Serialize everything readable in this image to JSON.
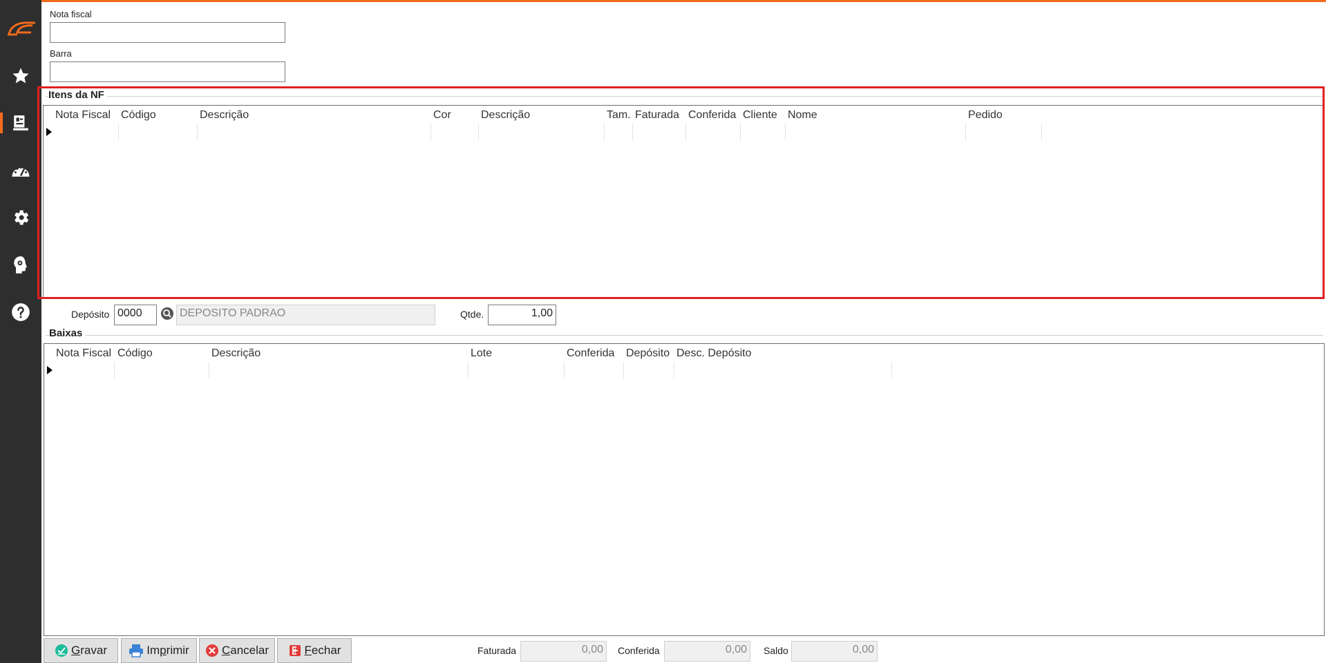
{
  "form": {
    "nota_fiscal_label": "Nota fiscal",
    "nota_fiscal_value": "",
    "barra_label": "Barra",
    "barra_value": ""
  },
  "itens": {
    "title": "Itens da NF",
    "columns": [
      "Nota Fiscal",
      "Código",
      "Descrição",
      "Cor",
      "Descrição",
      "Tam.",
      "Faturada",
      "Conferida",
      "Cliente",
      "Nome",
      "Pedido"
    ]
  },
  "deposito": {
    "label": "Depósito",
    "code": "0000",
    "name": "DEPOSITO PADRAO",
    "qtde_label": "Qtde.",
    "qtde_value": "1,00"
  },
  "baixas": {
    "title": "Baixas",
    "columns": [
      "Nota Fiscal",
      "Código",
      "Descrição",
      "Lote",
      "Conferida",
      "Depósito",
      "Desc. Depósito"
    ]
  },
  "buttons": {
    "gravar_first": "G",
    "gravar_rest": "ravar",
    "imprimir_a": "Im",
    "imprimir_u": "p",
    "imprimir_b": "rimir",
    "cancelar_first": "C",
    "cancelar_rest": "ancelar",
    "fechar_first": "F",
    "fechar_rest": "echar"
  },
  "totals": {
    "faturada_label": "Faturada",
    "faturada_value": "0,00",
    "conferida_label": "Conferida",
    "conferida_value": "0,00",
    "saldo_label": "Saldo",
    "saldo_value": "0,00"
  },
  "colors": {
    "accent": "#f26b1d",
    "highlight": "#e02020",
    "sidebar": "#2e2e2e"
  },
  "sidebar_icons": [
    "logo-icon",
    "star-icon",
    "register-icon",
    "speedometer-icon",
    "gear-icon",
    "head-gear-icon",
    "help-icon"
  ]
}
